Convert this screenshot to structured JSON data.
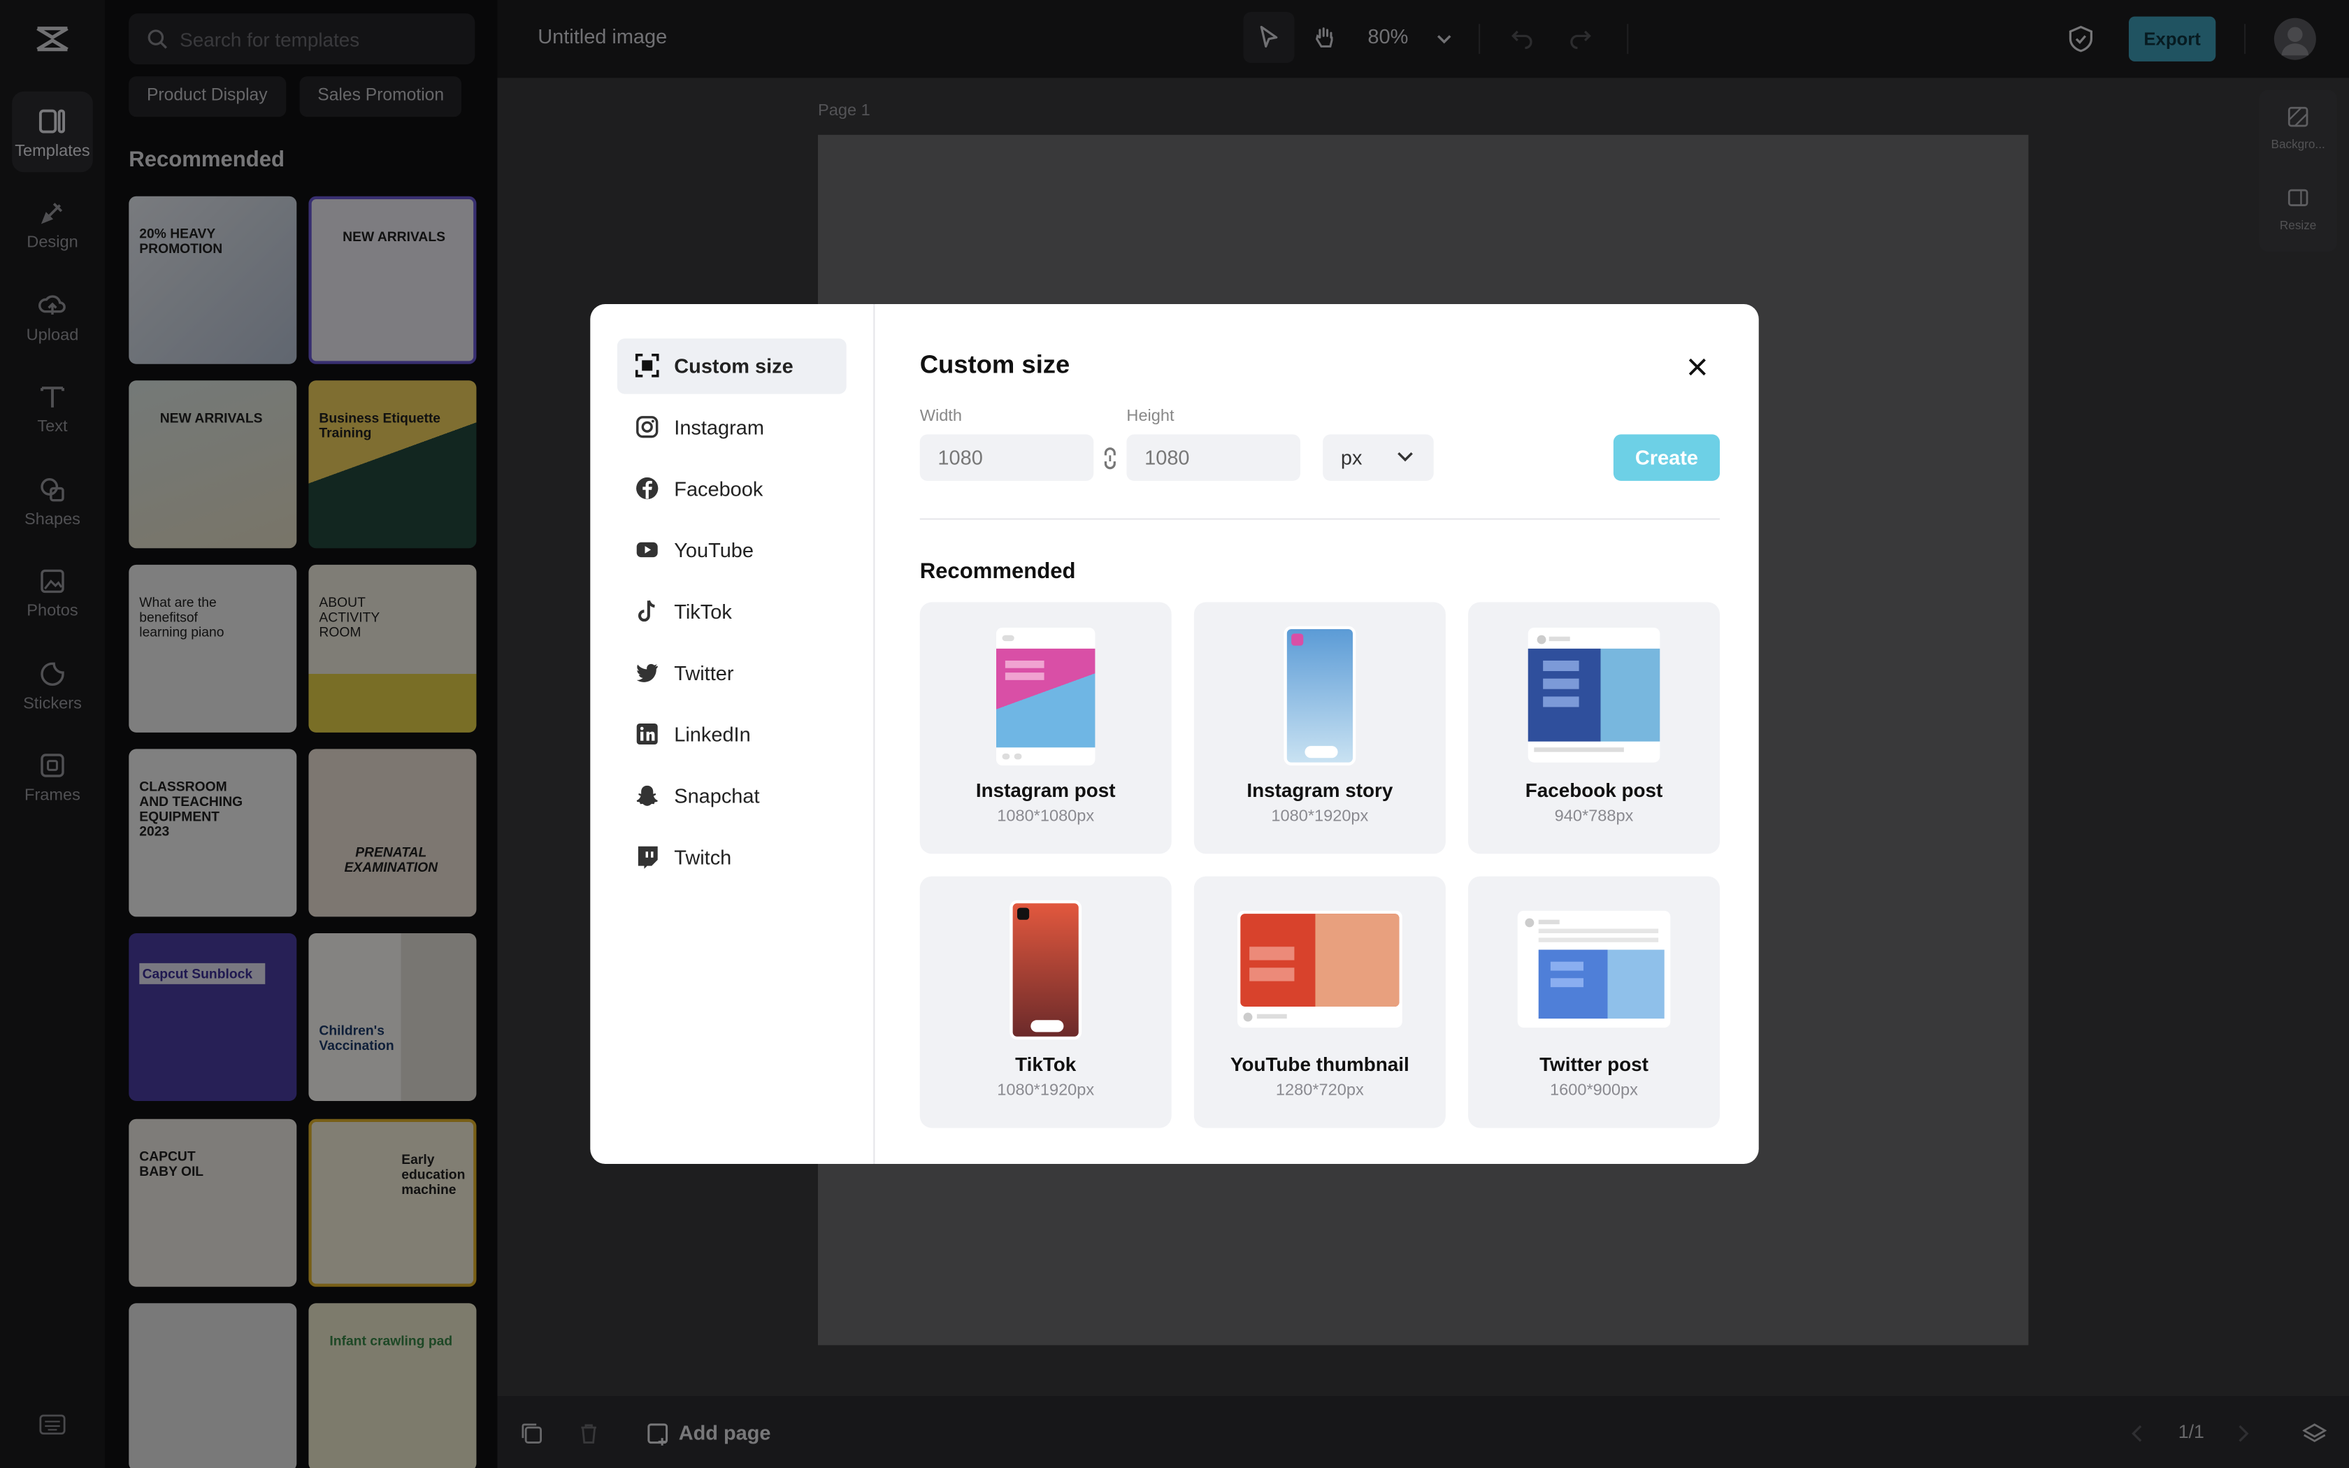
{
  "rail": {
    "items": [
      {
        "label": "Templates",
        "icon": "templates-icon"
      },
      {
        "label": "Design",
        "icon": "design-icon"
      },
      {
        "label": "Upload",
        "icon": "upload-icon"
      },
      {
        "label": "Text",
        "icon": "text-icon"
      },
      {
        "label": "Shapes",
        "icon": "shapes-icon"
      },
      {
        "label": "Photos",
        "icon": "photos-icon"
      },
      {
        "label": "Stickers",
        "icon": "stickers-icon"
      },
      {
        "label": "Frames",
        "icon": "frames-icon"
      }
    ]
  },
  "panel": {
    "search_placeholder": "Search for templates",
    "chips": [
      "Product Display",
      "Sales Promotion"
    ],
    "heading": "Recommended",
    "thumb_texts": [
      "20% HEAVY PROMOTION",
      "NEW ARRIVALS",
      "NEW ARRIVALS",
      "Business Etiquette Training",
      "What are the benefitsof learning piano",
      "ABOUT ACTIVITY ROOM",
      "CLASSROOM AND TEACHING EQUIPMENT 2023",
      "PRENATAL EXAMINATION",
      "Capcut Sunblock",
      "Children's Vaccination",
      "CAPCUT BABY OIL",
      "Early education machine",
      "",
      "Infant crawling pad"
    ]
  },
  "topbar": {
    "title": "Untitled image",
    "zoom": "80%",
    "export_label": "Export"
  },
  "canvas": {
    "page_label": "Page 1",
    "right_tools": [
      "Backgro...",
      "Resize"
    ],
    "add_page": "Add page",
    "pager": "1/1"
  },
  "dialog": {
    "sidebar": [
      {
        "label": "Custom size",
        "icon": "custom-size-icon"
      },
      {
        "label": "Instagram",
        "icon": "instagram-icon"
      },
      {
        "label": "Facebook",
        "icon": "facebook-icon"
      },
      {
        "label": "YouTube",
        "icon": "youtube-icon"
      },
      {
        "label": "TikTok",
        "icon": "tiktok-icon"
      },
      {
        "label": "Twitter",
        "icon": "twitter-icon"
      },
      {
        "label": "LinkedIn",
        "icon": "linkedin-icon"
      },
      {
        "label": "Snapchat",
        "icon": "snapchat-icon"
      },
      {
        "label": "Twitch",
        "icon": "twitch-icon"
      }
    ],
    "title": "Custom size",
    "width_label": "Width",
    "height_label": "Height",
    "width_value": "1080",
    "height_value": "1080",
    "unit": "px",
    "create_label": "Create",
    "recommended_label": "Recommended",
    "presets": [
      {
        "name": "Instagram post",
        "size": "1080*1080px"
      },
      {
        "name": "Instagram story",
        "size": "1080*1920px"
      },
      {
        "name": "Facebook post",
        "size": "940*788px"
      },
      {
        "name": "TikTok",
        "size": "1080*1920px"
      },
      {
        "name": "YouTube thumbnail",
        "size": "1280*720px"
      },
      {
        "name": "Twitter post",
        "size": "1600*900px"
      }
    ],
    "accent": "#6dd0e6"
  }
}
